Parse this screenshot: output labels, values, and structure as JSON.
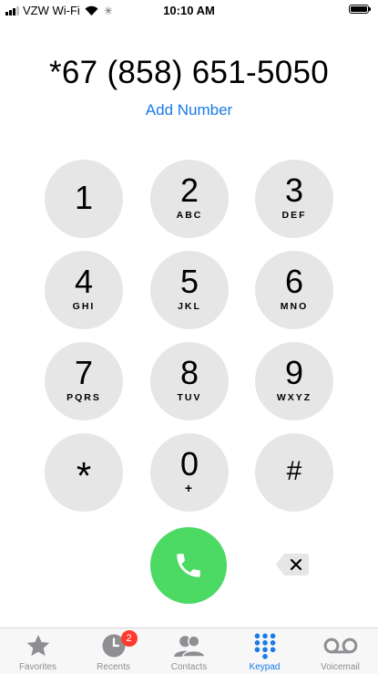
{
  "status_bar": {
    "carrier": "VZW Wi-Fi",
    "time": "10:10 AM"
  },
  "dialer": {
    "number": "*67 (858) 651-5050",
    "add_number_label": "Add Number"
  },
  "keypad": {
    "keys": [
      {
        "digit": "1",
        "letters": ""
      },
      {
        "digit": "2",
        "letters": "ABC"
      },
      {
        "digit": "3",
        "letters": "DEF"
      },
      {
        "digit": "4",
        "letters": "GHI"
      },
      {
        "digit": "5",
        "letters": "JKL"
      },
      {
        "digit": "6",
        "letters": "MNO"
      },
      {
        "digit": "7",
        "letters": "PQRS"
      },
      {
        "digit": "8",
        "letters": "TUV"
      },
      {
        "digit": "9",
        "letters": "WXYZ"
      },
      {
        "digit": "*",
        "letters": ""
      },
      {
        "digit": "0",
        "letters": "+"
      },
      {
        "digit": "#",
        "letters": ""
      }
    ]
  },
  "tab_bar": {
    "tabs": [
      {
        "label": "Favorites",
        "icon": "star-icon"
      },
      {
        "label": "Recents",
        "icon": "clock-icon",
        "badge": "2"
      },
      {
        "label": "Contacts",
        "icon": "contacts-icon"
      },
      {
        "label": "Keypad",
        "icon": "keypad-icon",
        "active": true
      },
      {
        "label": "Voicemail",
        "icon": "voicemail-icon"
      }
    ]
  },
  "colors": {
    "accent": "#1a7ae6",
    "call_green": "#4cd964",
    "key_gray": "#e6e6e6",
    "badge_red": "#ff3b30"
  }
}
